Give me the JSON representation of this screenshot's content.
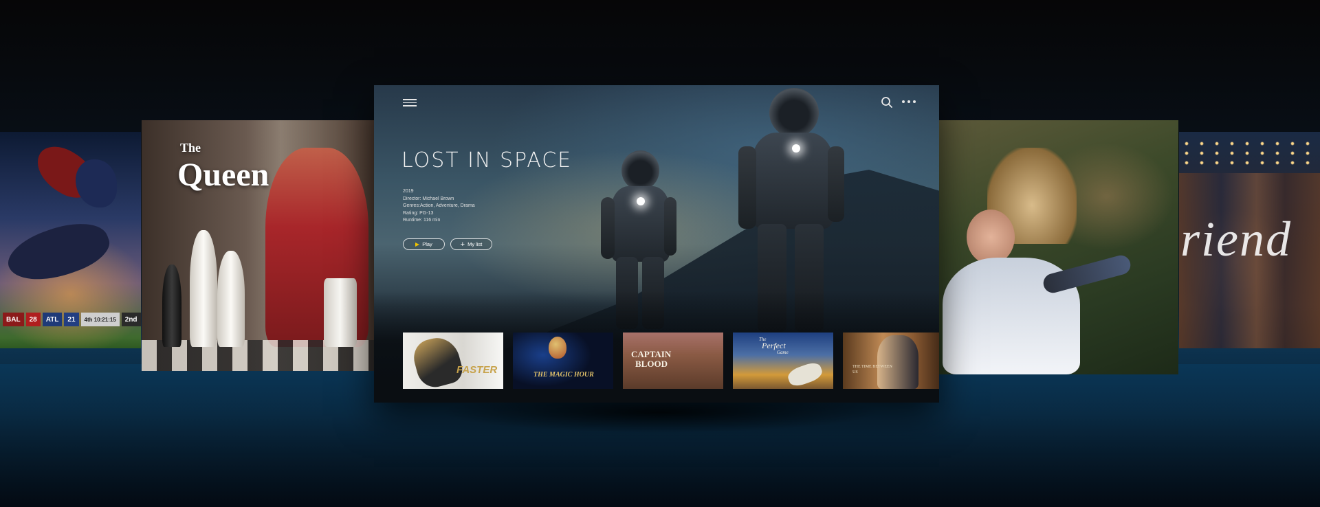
{
  "main": {
    "title": "LOST IN SPACE",
    "year": "2019",
    "director": "Director: Michael Brown",
    "genres": "Genres:Action, Adventure, Drama",
    "rating": "Rating: PG-13",
    "runtime": "Runtime: 116 min",
    "play_label": "Play",
    "mylist_label": "My list",
    "icons": [
      "menu-icon",
      "search-icon",
      "more-icon",
      "play-icon",
      "plus-icon"
    ]
  },
  "thumbnails": [
    {
      "title": "FASTER"
    },
    {
      "title": "THE MAGIC HOUR"
    },
    {
      "title_line1": "CAPTAIN",
      "title_line2": "BLOOD"
    },
    {
      "title_line1": "The",
      "title_line2": "Perfect",
      "title_line3": "Game"
    },
    {
      "title": "THE TIME BETWEEN US"
    }
  ],
  "side_panels": {
    "football": {
      "scoreboard": [
        {
          "text": "BAL",
          "bg": "#8b1a1a"
        },
        {
          "text": "28",
          "bg": "#b01e1e"
        },
        {
          "text": "ATL",
          "bg": "#1f3a78"
        },
        {
          "text": "21",
          "bg": "#233e82"
        },
        {
          "text": "4th 10:21:15",
          "bg": "#cfcfcf"
        },
        {
          "text": "2nd",
          "bg": "#2a2a2a"
        }
      ]
    },
    "queen": {
      "title_small": "The",
      "title_large": "Queen"
    },
    "friends": {
      "title": "riend"
    }
  },
  "colors": {
    "accent_play": "#f0c300",
    "background": "#07121c",
    "floor": "#0d3350"
  }
}
